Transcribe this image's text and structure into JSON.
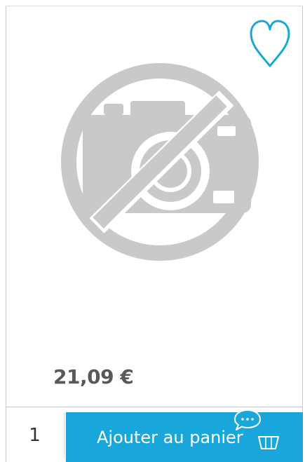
{
  "product": {
    "price": "21,09 €",
    "quantity": "1"
  },
  "actions": {
    "add_to_cart_label": "Ajouter au panier"
  },
  "icons": {
    "wishlist": "heart-outline-icon",
    "image_placeholder": "no-camera-icon",
    "cart": "basket-icon",
    "chat": "chat-bubble-icon"
  },
  "colors": {
    "accent": "#19a7db",
    "price": "#595959",
    "placeholder": "#c9c9c9"
  }
}
